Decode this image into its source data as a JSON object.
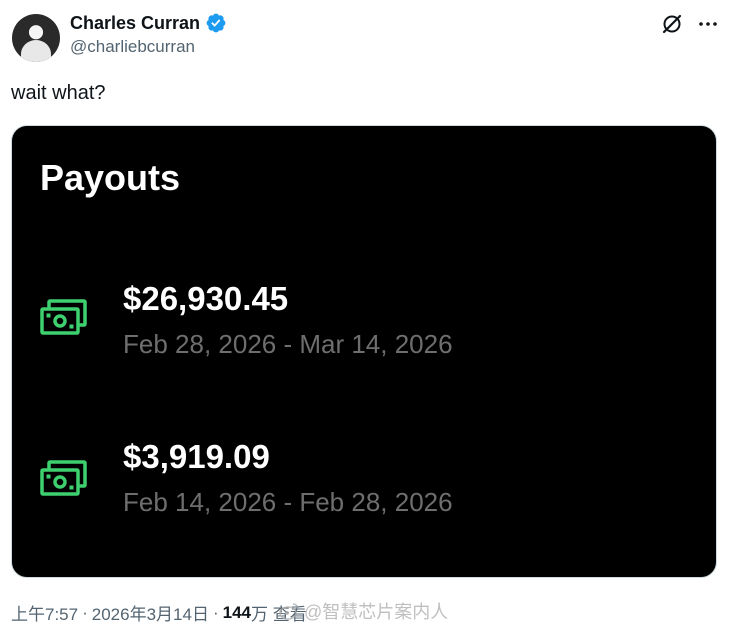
{
  "author": {
    "name": "Charles Curran",
    "handle": "@charliebcurran"
  },
  "tweet": {
    "text": "wait what?"
  },
  "media": {
    "title": "Payouts",
    "payouts": [
      {
        "amount": "$26,930.45",
        "date_range": "Feb 28, 2026 - Mar 14, 2026"
      },
      {
        "amount": "$3,919.09",
        "date_range": "Feb 14, 2026 - Feb 28, 2026"
      }
    ]
  },
  "meta": {
    "time": "上午7:57",
    "date": "2026年3月14日",
    "views_num": "144",
    "views_label": "万 查看"
  },
  "watermark": {
    "text": "@智慧芯片案内人"
  },
  "colors": {
    "verified": "#1d9bf0",
    "cash_icon": "#3ecf6e",
    "secondary_text": "#536471"
  }
}
